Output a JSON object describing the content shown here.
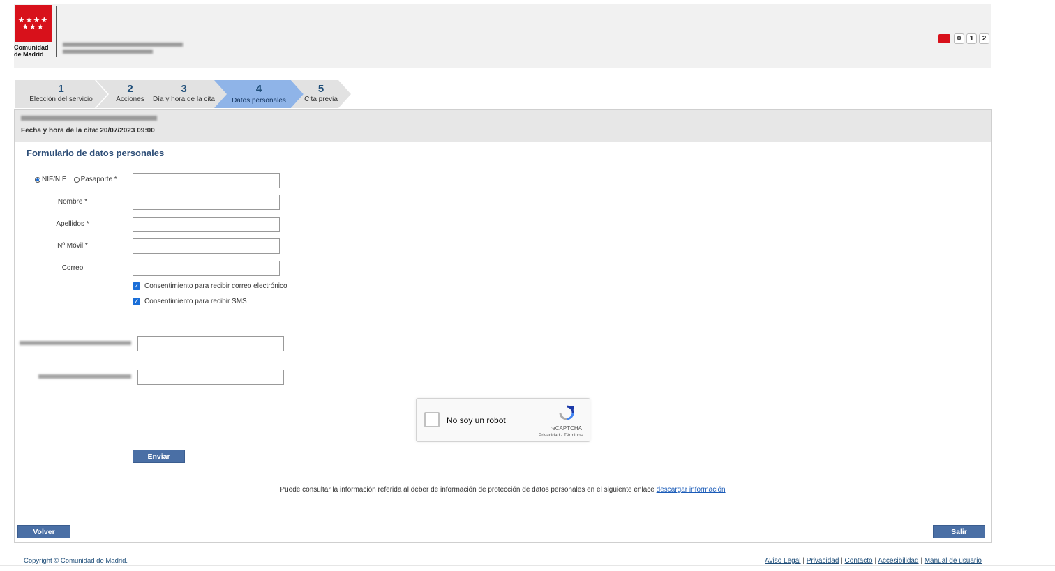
{
  "header": {
    "logo_text": "Comunidad de Madrid",
    "phone_digits": [
      "0",
      "1",
      "2"
    ]
  },
  "steps": [
    {
      "number": "1",
      "label": "Elección del servicio"
    },
    {
      "number": "2",
      "label": "Acciones"
    },
    {
      "number": "3",
      "label": "Día y hora de la cita"
    },
    {
      "number": "4",
      "label": "Datos personales",
      "active": true
    },
    {
      "number": "5",
      "label": "Cita previa"
    }
  ],
  "appointment": {
    "datetime_text": "Fecha y hora de la cita: 20/07/2023 09:00"
  },
  "form": {
    "title": "Formulario de datos personales",
    "id_options": {
      "nif": "NIF/NIE",
      "passport": "Pasaporte *"
    },
    "fields": {
      "nombre": "Nombre *",
      "apellidos": "Apellidos *",
      "movil": "Nº Móvil *",
      "correo": "Correo"
    },
    "consents": {
      "email": "Consentimiento para recibir correo electrónico",
      "sms": "Consentimiento para recibir SMS"
    }
  },
  "captcha": {
    "label": "No soy un robot",
    "brand": "reCAPTCHA",
    "links": "Privacidad - Términos"
  },
  "actions": {
    "submit": "Enviar",
    "back": "Volver",
    "exit": "Salir"
  },
  "info": {
    "text": "Puede consultar la información referida al deber de información de protección de datos personales en el siguiente enlace ",
    "link": "descargar información"
  },
  "footer": {
    "copyright": "Copyright © Comunidad de Madrid.",
    "links": [
      "Aviso Legal",
      "Privacidad",
      "Contacto",
      "Accesibilidad",
      "Manual de usuario"
    ]
  }
}
